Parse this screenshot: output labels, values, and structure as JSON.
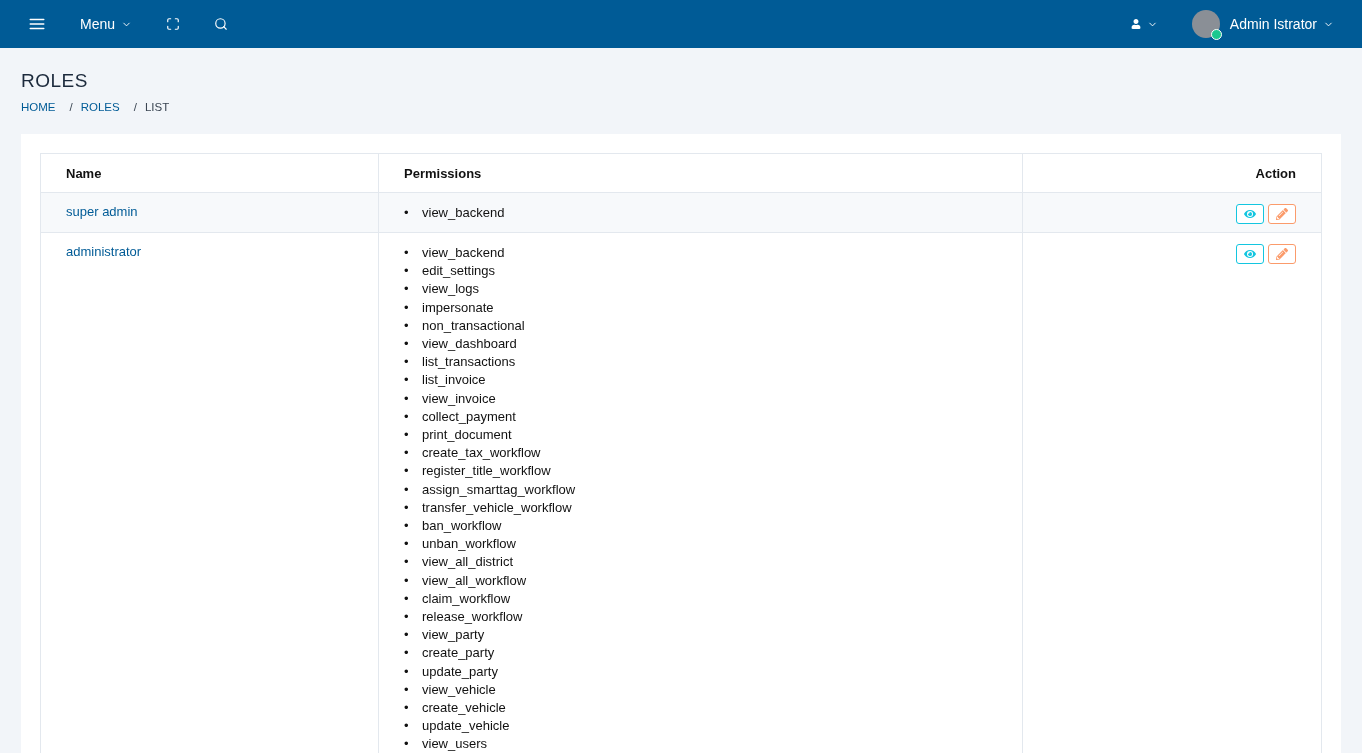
{
  "topbar": {
    "menu_label": "Menu",
    "user_name": "Admin Istrator"
  },
  "page": {
    "title": "ROLES",
    "breadcrumb": [
      {
        "label": "HOME",
        "link": true
      },
      {
        "separator": "/",
        "label": "ROLES",
        "link": true
      },
      {
        "separator": "/",
        "label": "LIST",
        "link": false
      }
    ]
  },
  "table": {
    "columns": [
      "Name",
      "Permissions",
      "Action"
    ],
    "rows": [
      {
        "name": "super admin",
        "permissions": [
          {
            "marker": "•",
            "label": "view_backend"
          }
        ]
      },
      {
        "name": "administrator",
        "permissions": [
          {
            "marker": "•",
            "label": "view_backend"
          },
          {
            "marker": "•",
            "label": "edit_settings"
          },
          {
            "marker": "•",
            "label": "view_logs"
          },
          {
            "marker": "•",
            "label": "impersonate"
          },
          {
            "marker": "•",
            "label": "non_transactional"
          },
          {
            "marker": "•",
            "label": "view_dashboard"
          },
          {
            "marker": "•",
            "label": "list_transactions"
          },
          {
            "marker": "•",
            "label": "list_invoice"
          },
          {
            "marker": "•",
            "label": "view_invoice"
          },
          {
            "marker": "•",
            "label": "collect_payment"
          },
          {
            "marker": "•",
            "label": "print_document"
          },
          {
            "marker": "•",
            "label": "create_tax_workflow"
          },
          {
            "marker": "•",
            "label": "register_title_workflow"
          },
          {
            "marker": "•",
            "label": "assign_smarttag_workflow"
          },
          {
            "marker": "•",
            "label": "transfer_vehicle_workflow"
          },
          {
            "marker": "•",
            "label": "ban_workflow"
          },
          {
            "marker": "•",
            "label": "unban_workflow"
          },
          {
            "marker": "•",
            "label": "view_all_district"
          },
          {
            "marker": "•",
            "label": "view_all_workflow"
          },
          {
            "marker": "•",
            "label": "claim_workflow"
          },
          {
            "marker": "•",
            "label": "release_workflow"
          },
          {
            "marker": "•",
            "label": "view_party"
          },
          {
            "marker": "•",
            "label": "create_party"
          },
          {
            "marker": "•",
            "label": "update_party"
          },
          {
            "marker": "•",
            "label": "view_vehicle"
          },
          {
            "marker": "•",
            "label": "create_vehicle"
          },
          {
            "marker": "•",
            "label": "update_vehicle"
          },
          {
            "marker": "•",
            "label": "view_users"
          }
        ]
      }
    ]
  }
}
